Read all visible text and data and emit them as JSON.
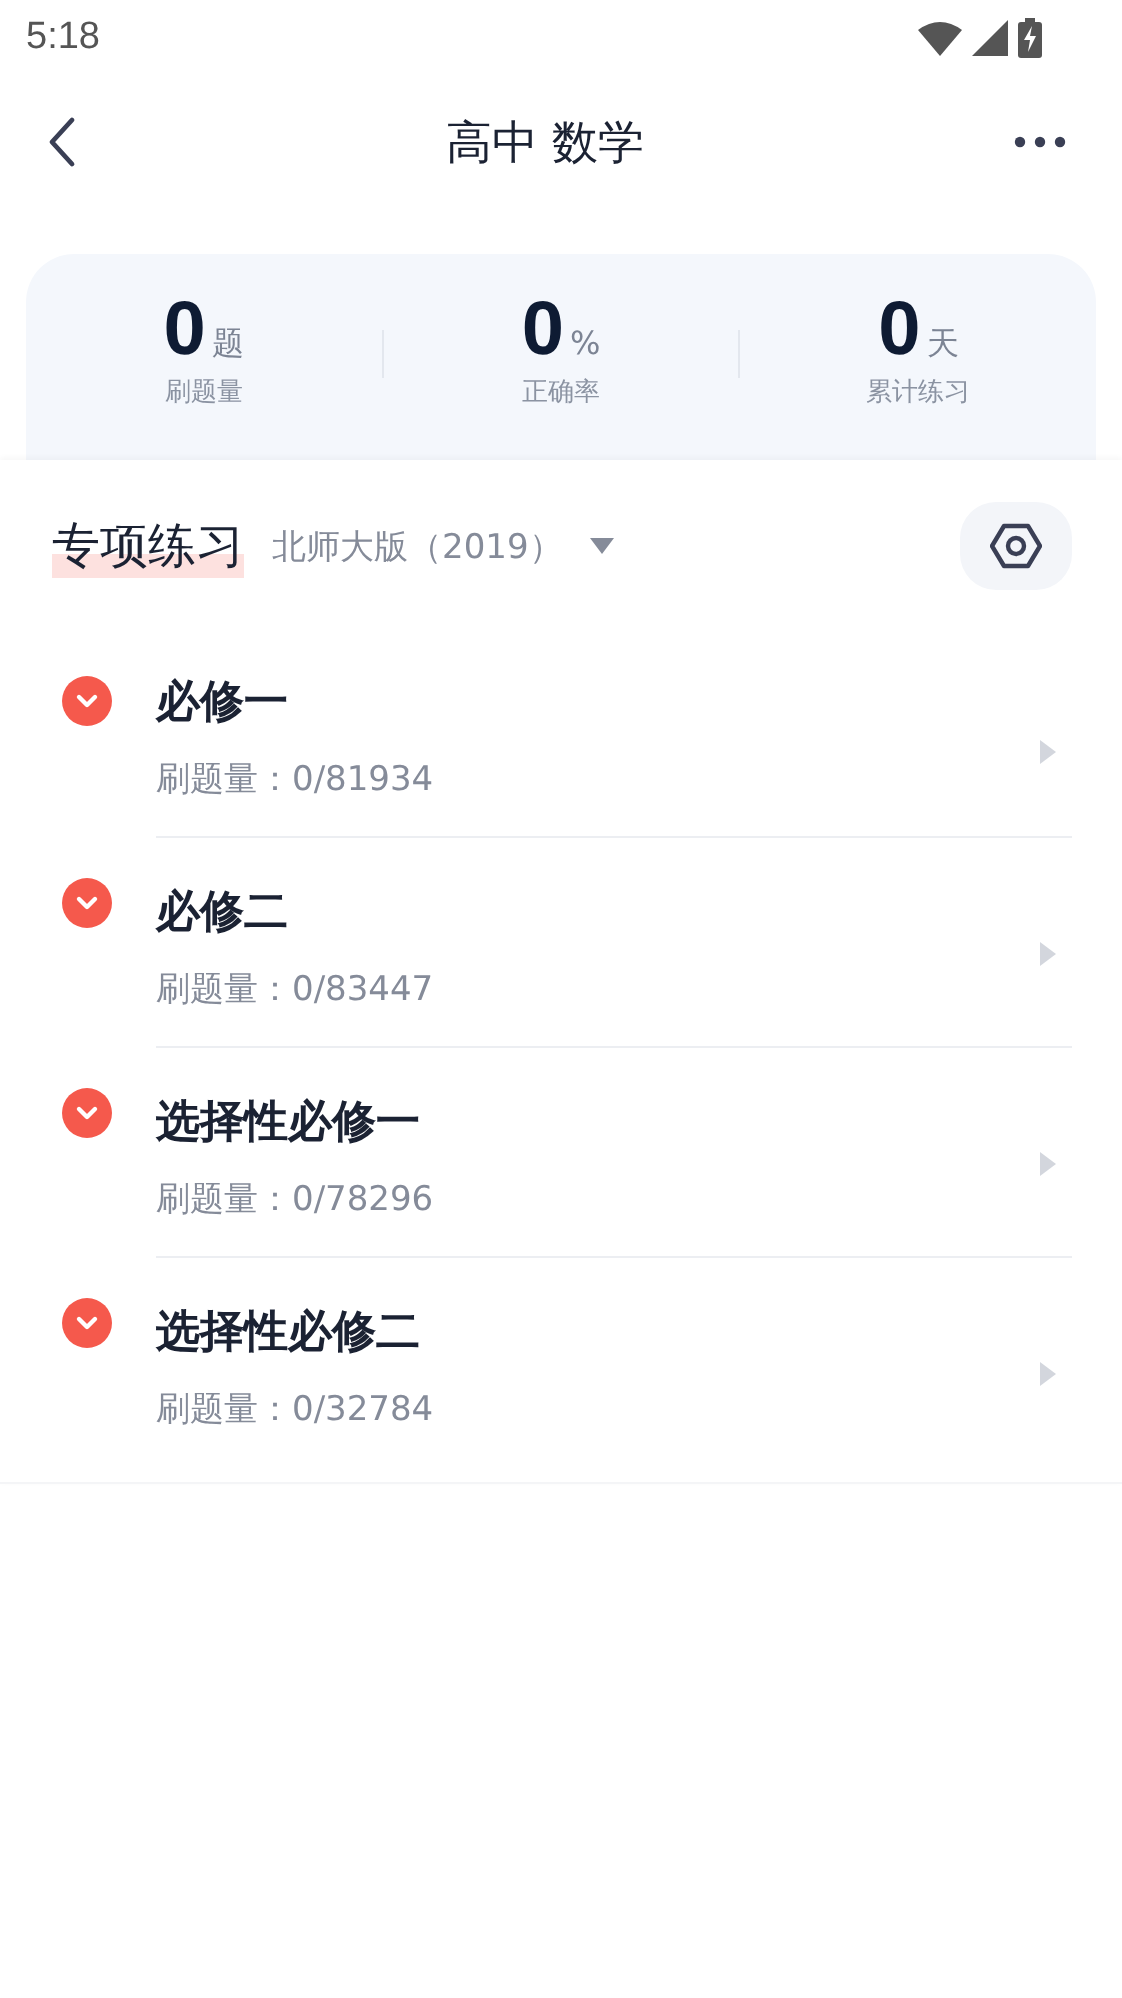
{
  "status_bar": {
    "time": "5:18"
  },
  "header": {
    "title": "高中 数学"
  },
  "stats": [
    {
      "value": "0",
      "unit": "题",
      "label": "刷题量"
    },
    {
      "value": "0",
      "unit": "%",
      "label": "正确率"
    },
    {
      "value": "0",
      "unit": "天",
      "label": "累计练习"
    }
  ],
  "section": {
    "title": "专项练习",
    "edition": "北师大版（2019）"
  },
  "items": [
    {
      "title": "必修一",
      "count": "刷题量：0/81934"
    },
    {
      "title": "必修二",
      "count": "刷题量：0/83447"
    },
    {
      "title": "选择性必修一",
      "count": "刷题量：0/78296"
    },
    {
      "title": "选择性必修二",
      "count": "刷题量：0/32784"
    }
  ]
}
